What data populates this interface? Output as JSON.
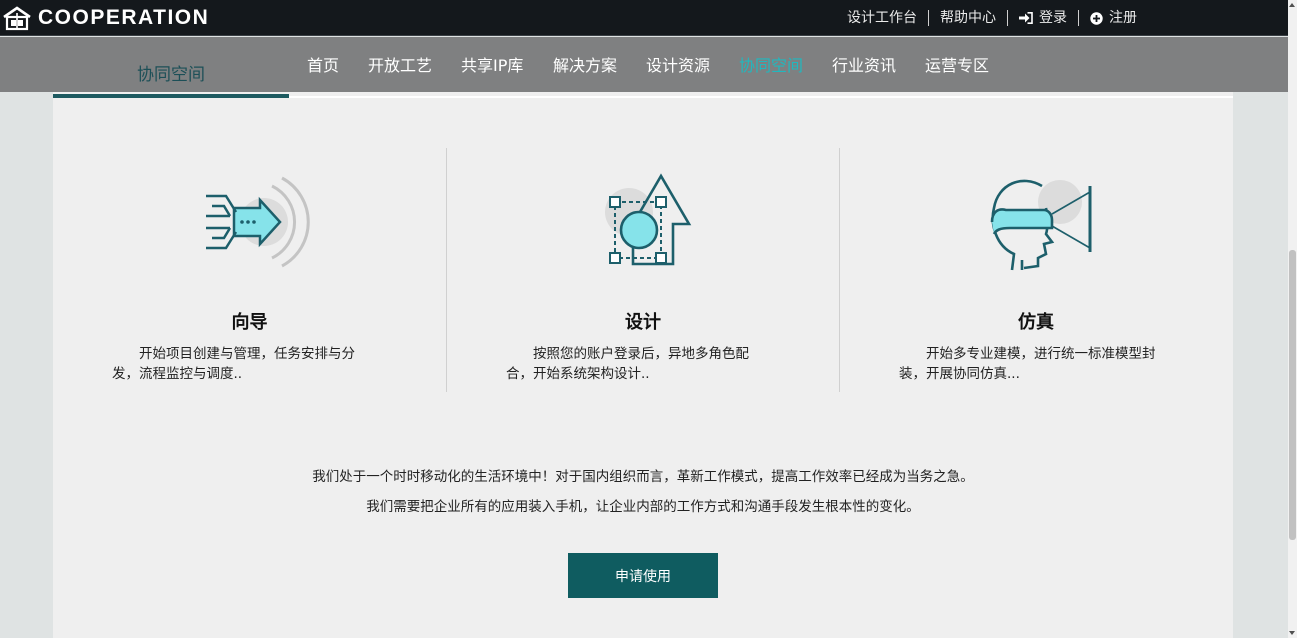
{
  "brand": {
    "name": "COOPERATION",
    "icon": "cooperation-logo-icon"
  },
  "top_links": [
    {
      "label": "设计工作台",
      "icon": ""
    },
    {
      "label": "帮助中心",
      "icon": ""
    },
    {
      "label": "登录",
      "icon": "sign-in-icon"
    },
    {
      "label": "注册",
      "icon": "plus-circle-icon"
    }
  ],
  "nav": [
    {
      "label": "首页"
    },
    {
      "label": "开放工艺"
    },
    {
      "label": "共享IP库"
    },
    {
      "label": "解决方案"
    },
    {
      "label": "设计资源"
    },
    {
      "label": "协同空间",
      "active": true
    },
    {
      "label": "行业资讯"
    },
    {
      "label": "运营专区"
    }
  ],
  "sub_tab": {
    "label": "协同空间"
  },
  "features": [
    {
      "title": "向导",
      "description": "开始项目创建与管理，任务安排与分发，流程监控与调度..",
      "icon": "wizard-arrow-icon"
    },
    {
      "title": "设计",
      "description": "按照您的账户登录后，异地多角色配合，开始系统架构设计..",
      "icon": "design-shapes-icon"
    },
    {
      "title": "仿真",
      "description": "开始多专业建模，进行统一标准模型封装，开展协同仿真...",
      "icon": "vr-headset-icon"
    }
  ],
  "intro": {
    "line1": "我们处于一个时时移动化的生活环境中！对于国内组织而言，革新工作模式，提高工作效率已经成为当务之急。",
    "line2": "我们需要把企业所有的应用装入手机，让企业内部的工作方式和沟通手段发生根本性的变化。"
  },
  "apply_button": {
    "label": "申请使用"
  },
  "colors": {
    "accent": "#20b8bf",
    "button": "#0f5c60",
    "topbar": "#14181c",
    "navbar": "#7f8081",
    "icon_stroke": "#1d5f6b"
  }
}
